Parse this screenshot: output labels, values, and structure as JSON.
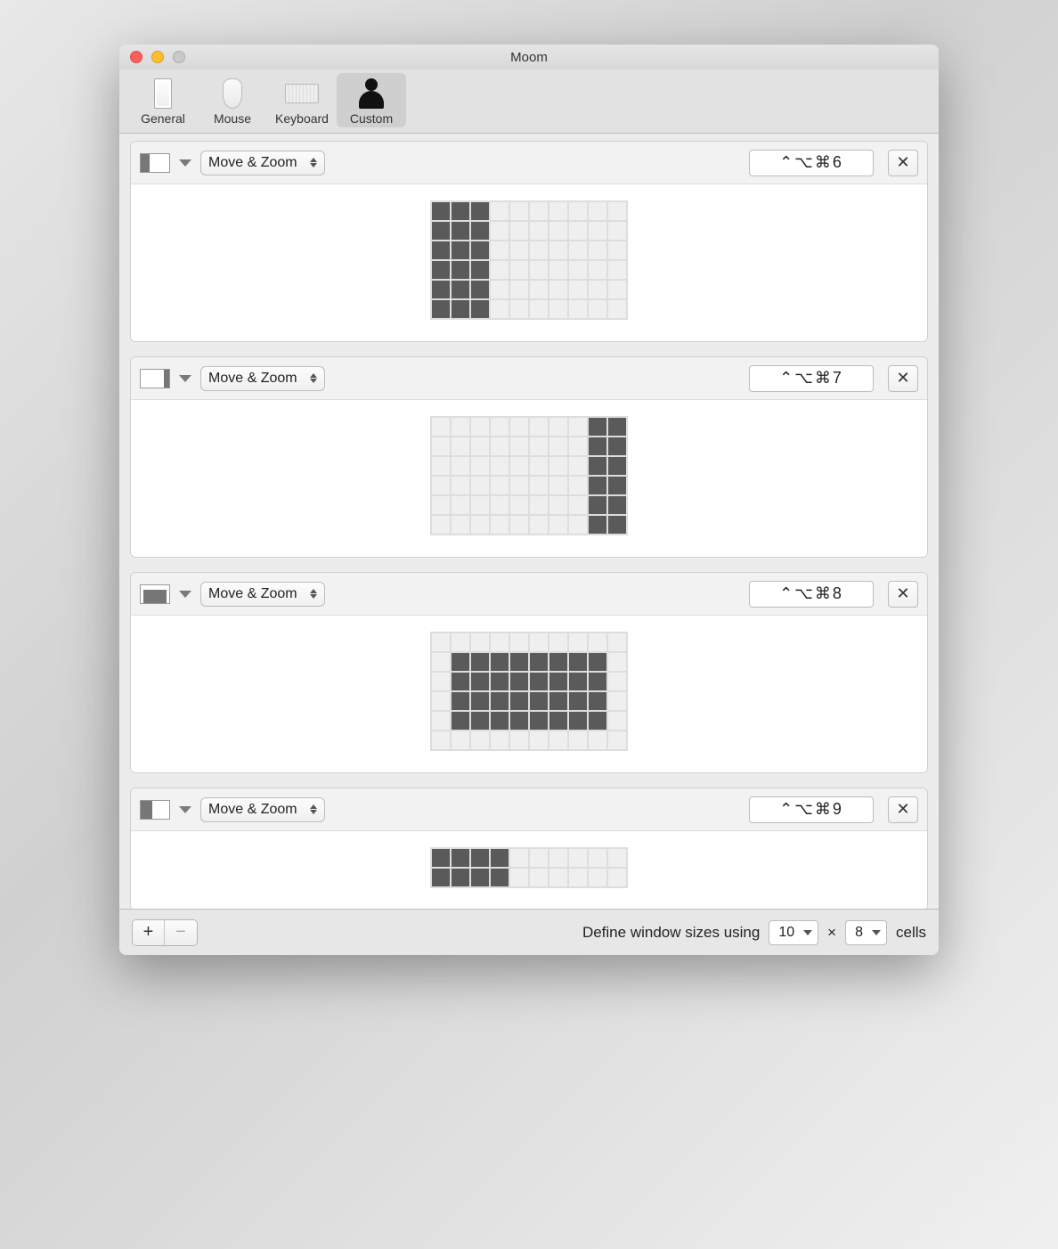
{
  "window": {
    "title": "Moom"
  },
  "toolbar": {
    "items": [
      {
        "label": "General"
      },
      {
        "label": "Mouse"
      },
      {
        "label": "Keyboard"
      },
      {
        "label": "Custom"
      }
    ],
    "active_index": 3
  },
  "grid_dims": {
    "cols": 10,
    "rows": 6
  },
  "rows": [
    {
      "action_label": "Move & Zoom",
      "shortcut": "⌃⌥⌘6",
      "thumb": {
        "col_start": 0,
        "col_end": 3,
        "row_start": 0,
        "row_end": 6
      },
      "selection": {
        "col_start": 0,
        "col_end": 3,
        "row_start": 0,
        "row_end": 6
      }
    },
    {
      "action_label": "Move & Zoom",
      "shortcut": "⌃⌥⌘7",
      "thumb": {
        "col_start": 8,
        "col_end": 10,
        "row_start": 0,
        "row_end": 6
      },
      "selection": {
        "col_start": 8,
        "col_end": 10,
        "row_start": 0,
        "row_end": 6
      }
    },
    {
      "action_label": "Move & Zoom",
      "shortcut": "⌃⌥⌘8",
      "thumb": {
        "col_start": 1,
        "col_end": 9,
        "row_start": 1,
        "row_end": 5
      },
      "selection": {
        "col_start": 1,
        "col_end": 9,
        "row_start": 1,
        "row_end": 5
      }
    },
    {
      "action_label": "Move & Zoom",
      "shortcut": "⌃⌥⌘9",
      "thumb": {
        "col_start": 0,
        "col_end": 4,
        "row_start": 0,
        "row_end": 6
      },
      "selection": {
        "col_start": 0,
        "col_end": 4,
        "row_start": 0,
        "row_end": 6
      },
      "truncated_rows": 2
    }
  ],
  "footer": {
    "define_label": "Define window sizes using",
    "cols_value": "10",
    "times": "×",
    "rows_value": "8",
    "cells_label": "cells"
  }
}
